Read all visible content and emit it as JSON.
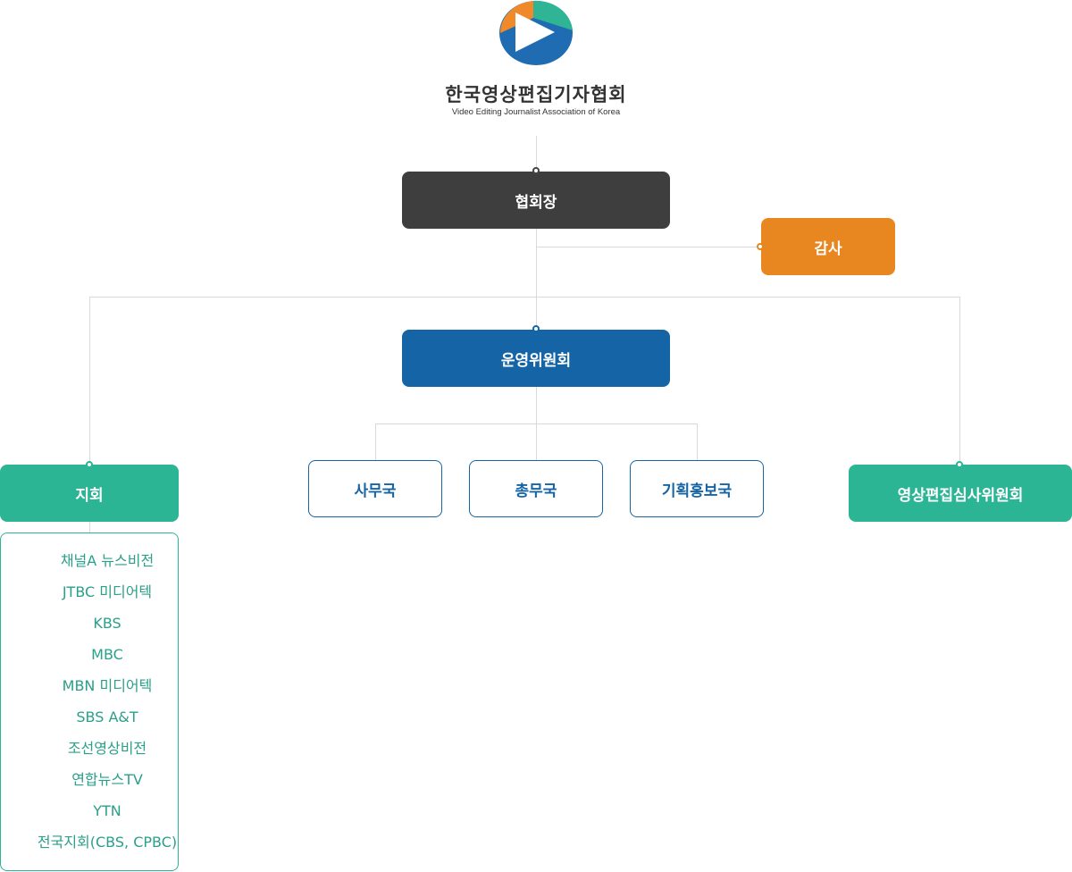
{
  "header": {
    "org_name_ko": "한국영상편집기자협회",
    "org_name_en": "Video Editing Journalist Association of Korea"
  },
  "nodes": {
    "president": "협회장",
    "auditor": "감사",
    "steering_committee": "운영위원회",
    "branches": "지회",
    "secretariat": "사무국",
    "general_affairs": "총무국",
    "planning_pr": "기획홍보국",
    "review_committee": "영상편집심사위원회"
  },
  "branch_list": [
    "채널A 뉴스비전",
    "JTBC 미디어텍",
    "KBS",
    "MBC",
    "MBN 미디어텍",
    "SBS A&T",
    "조선영상비전",
    "연합뉴스TV",
    "YTN",
    "전국지회(CBS, CPBC)"
  ],
  "colors": {
    "president": "#3e3e3e",
    "auditor": "#e8861f",
    "steering": "#1565a6",
    "teal": "#2bb595",
    "line": "#d9d9d9"
  },
  "icons": {
    "logo": "play-circle-logo"
  }
}
